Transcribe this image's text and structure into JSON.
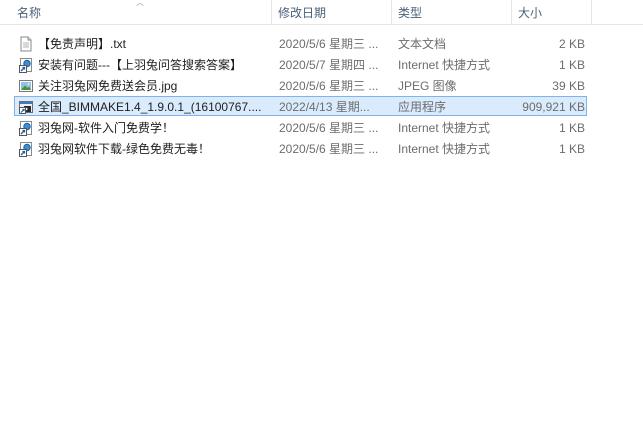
{
  "columns": {
    "name": "名称",
    "date": "修改日期",
    "type": "类型",
    "size": "大小"
  },
  "files": [
    {
      "name": "【免责声明】.txt",
      "date": "2020/5/6 星期三 ...",
      "type": "文本文档",
      "size": "2 KB",
      "icon": "text-file-icon"
    },
    {
      "name": "安装有问题---【上羽兔问答搜索答案】",
      "date": "2020/5/7 星期四 ...",
      "type": "Internet 快捷方式",
      "size": "1 KB",
      "icon": "internet-shortcut-icon"
    },
    {
      "name": "关注羽兔网免费送会员.jpg",
      "date": "2020/5/6 星期三 ...",
      "type": "JPEG 图像",
      "size": "39 KB",
      "icon": "image-file-icon"
    },
    {
      "name": "全国_BIMMAKE1.4_1.9.0.1_(16100767....",
      "date": "2022/4/13 星期...",
      "type": "应用程序",
      "size": "909,921 KB",
      "icon": "application-icon"
    },
    {
      "name": "羽兔网-软件入门免费学！",
      "date": "2020/5/6 星期三 ...",
      "type": "Internet 快捷方式",
      "size": "1 KB",
      "icon": "internet-shortcut-icon"
    },
    {
      "name": "羽兔网软件下载-绿色免费无毒！",
      "date": "2020/5/6 星期三 ...",
      "type": "Internet 快捷方式",
      "size": "1 KB",
      "icon": "internet-shortcut-icon"
    }
  ],
  "selected_index": 3,
  "colors": {
    "header_text": "#4c607a",
    "selection_bg": "#d9ebfc",
    "selection_border": "#7eb4ea"
  }
}
